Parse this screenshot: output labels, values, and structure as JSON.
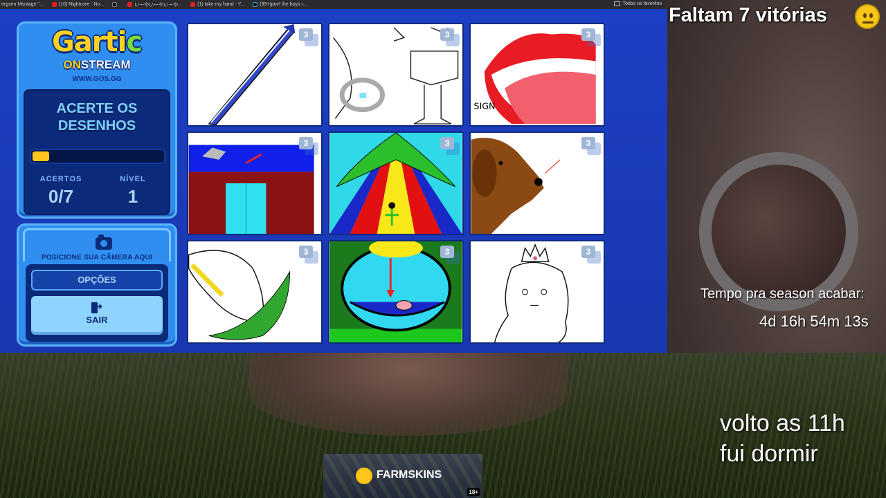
{
  "bookmarks": {
    "items": [
      {
        "label": "ergsen Montage \"..."
      },
      {
        "label": "(10) Nightcore - No..."
      },
      {
        "label": ""
      },
      {
        "label": "いーやいーやいーや..."
      },
      {
        "label": "(1) take my hand - Y..."
      },
      {
        "label": "(99+)pov! the boys r..."
      }
    ],
    "all_favorites": "Todos os favoritos"
  },
  "game": {
    "logo_main": "Gartic",
    "logo_on": "ON",
    "logo_stream": "STREAM",
    "logo_url": "WWW.GOS.GG",
    "mode_title_line1": "ACERTE OS",
    "mode_title_line2": "DESENHOS",
    "progress": 0,
    "acertos_label": "ACERTOS",
    "acertos_value": "0/7",
    "nivel_label": "NÍVEL",
    "nivel_value": "1",
    "camera_text": "POSICIONE SUA CÂMERA AQUI",
    "options_label": "OPÇÕES",
    "exit_label": "SAIR",
    "drawings": [
      {
        "badge": "3",
        "subject": "pen"
      },
      {
        "badge": "3",
        "subject": "bathroom"
      },
      {
        "badge": "3",
        "subject": "mouth"
      },
      {
        "badge": "3",
        "subject": "house"
      },
      {
        "badge": "3",
        "subject": "circus-tent"
      },
      {
        "badge": "3",
        "subject": "dog"
      },
      {
        "badge": "3",
        "subject": "calla-lily"
      },
      {
        "badge": "3",
        "subject": "hammock"
      },
      {
        "badge": "3",
        "subject": "princess"
      }
    ]
  },
  "overlay": {
    "wins_text": "Faltam 7 vitórias",
    "season_label": "Tempo pra season acabar:",
    "season_timer": "4d 16h 54m 13s",
    "status_line1": "volto as 11h",
    "status_line2": "fui dormir",
    "sponsor": "FARMSKINS",
    "sponsor_age": "18+"
  },
  "colors": {
    "game_bg": "#1d3fc4",
    "panel": "#2f8ef0",
    "accent_yellow": "#ffc51a",
    "dark_blue": "#0c2a7a"
  }
}
